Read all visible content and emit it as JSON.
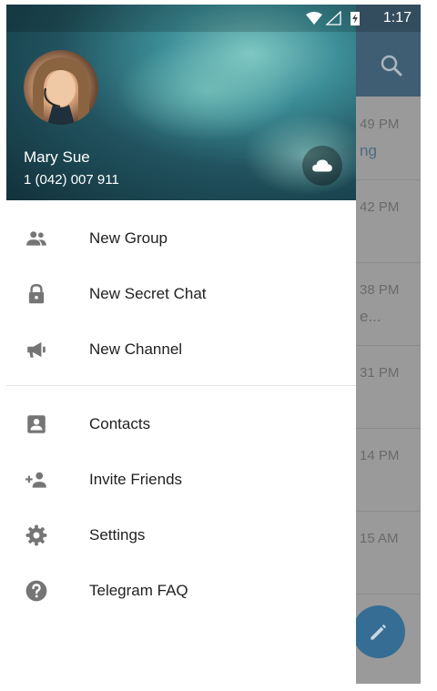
{
  "status_bar": {
    "time": "1:17"
  },
  "background": {
    "rows": [
      {
        "time": "49 PM",
        "sub": "ng"
      },
      {
        "time": "42 PM",
        "sub": ""
      },
      {
        "time": "38 PM",
        "sub": "e..."
      },
      {
        "time": "31 PM",
        "sub": ""
      },
      {
        "time": "14 PM",
        "sub": ""
      },
      {
        "time": "15 AM",
        "sub": ""
      }
    ]
  },
  "drawer": {
    "user": {
      "name": "Mary Sue",
      "phone": "1 (042) 007 911"
    },
    "items": [
      {
        "label": "New Group",
        "icon": "group-icon"
      },
      {
        "label": "New Secret Chat",
        "icon": "lock-icon"
      },
      {
        "label": "New Channel",
        "icon": "megaphone-icon"
      },
      {
        "label": "Contacts",
        "icon": "contact-card-icon"
      },
      {
        "label": "Invite Friends",
        "icon": "add-person-icon"
      },
      {
        "label": "Settings",
        "icon": "gear-icon"
      },
      {
        "label": "Telegram FAQ",
        "icon": "help-icon"
      }
    ]
  },
  "colors": {
    "header_bar": "#3f5e73",
    "fab": "#356d94",
    "icon_gray": "#757575"
  }
}
